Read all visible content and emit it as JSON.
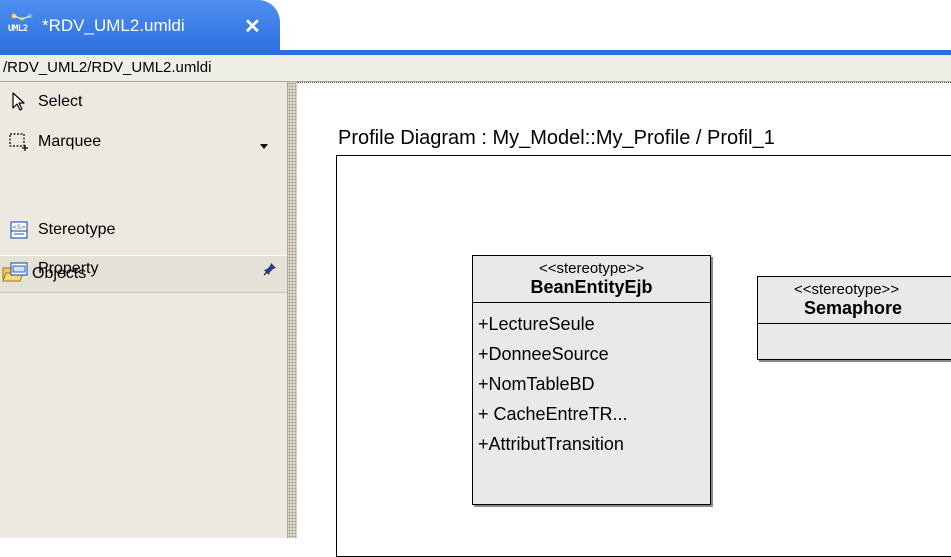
{
  "tab": {
    "icon_label": "UML2",
    "title": "*RDV_UML2.umldi",
    "close_symbol": "✕"
  },
  "path": "/RDV_UML2/RDV_UML2.umldi",
  "palette": {
    "tools": [
      {
        "label": "Select",
        "icon": "arrow-cursor-icon"
      },
      {
        "label": "Marquee",
        "icon": "marquee-icon"
      }
    ],
    "drawer_label": "Objects",
    "objects": [
      {
        "label": "Stereotype",
        "icon": "stereotype-icon"
      },
      {
        "label": "Property",
        "icon": "property-icon"
      }
    ]
  },
  "diagram": {
    "label": "Profile Diagram : My_Model::My_Profile / Profil_1",
    "stereotypes": [
      {
        "keyword": "<<stereotype>>",
        "name": "BeanEntityEjb",
        "attributes": [
          "+LectureSeule",
          "+DonneeSource",
          "+NomTableBD",
          "+ CacheEntreTR...",
          "+AttributTransition"
        ]
      },
      {
        "keyword": "<<stereotype>>",
        "name": "Semaphore",
        "attributes": []
      }
    ]
  },
  "colors": {
    "tab_blue": "#2c6fdc",
    "palette_bg": "#ede9e0",
    "class_fill": "#e9e9e9"
  }
}
